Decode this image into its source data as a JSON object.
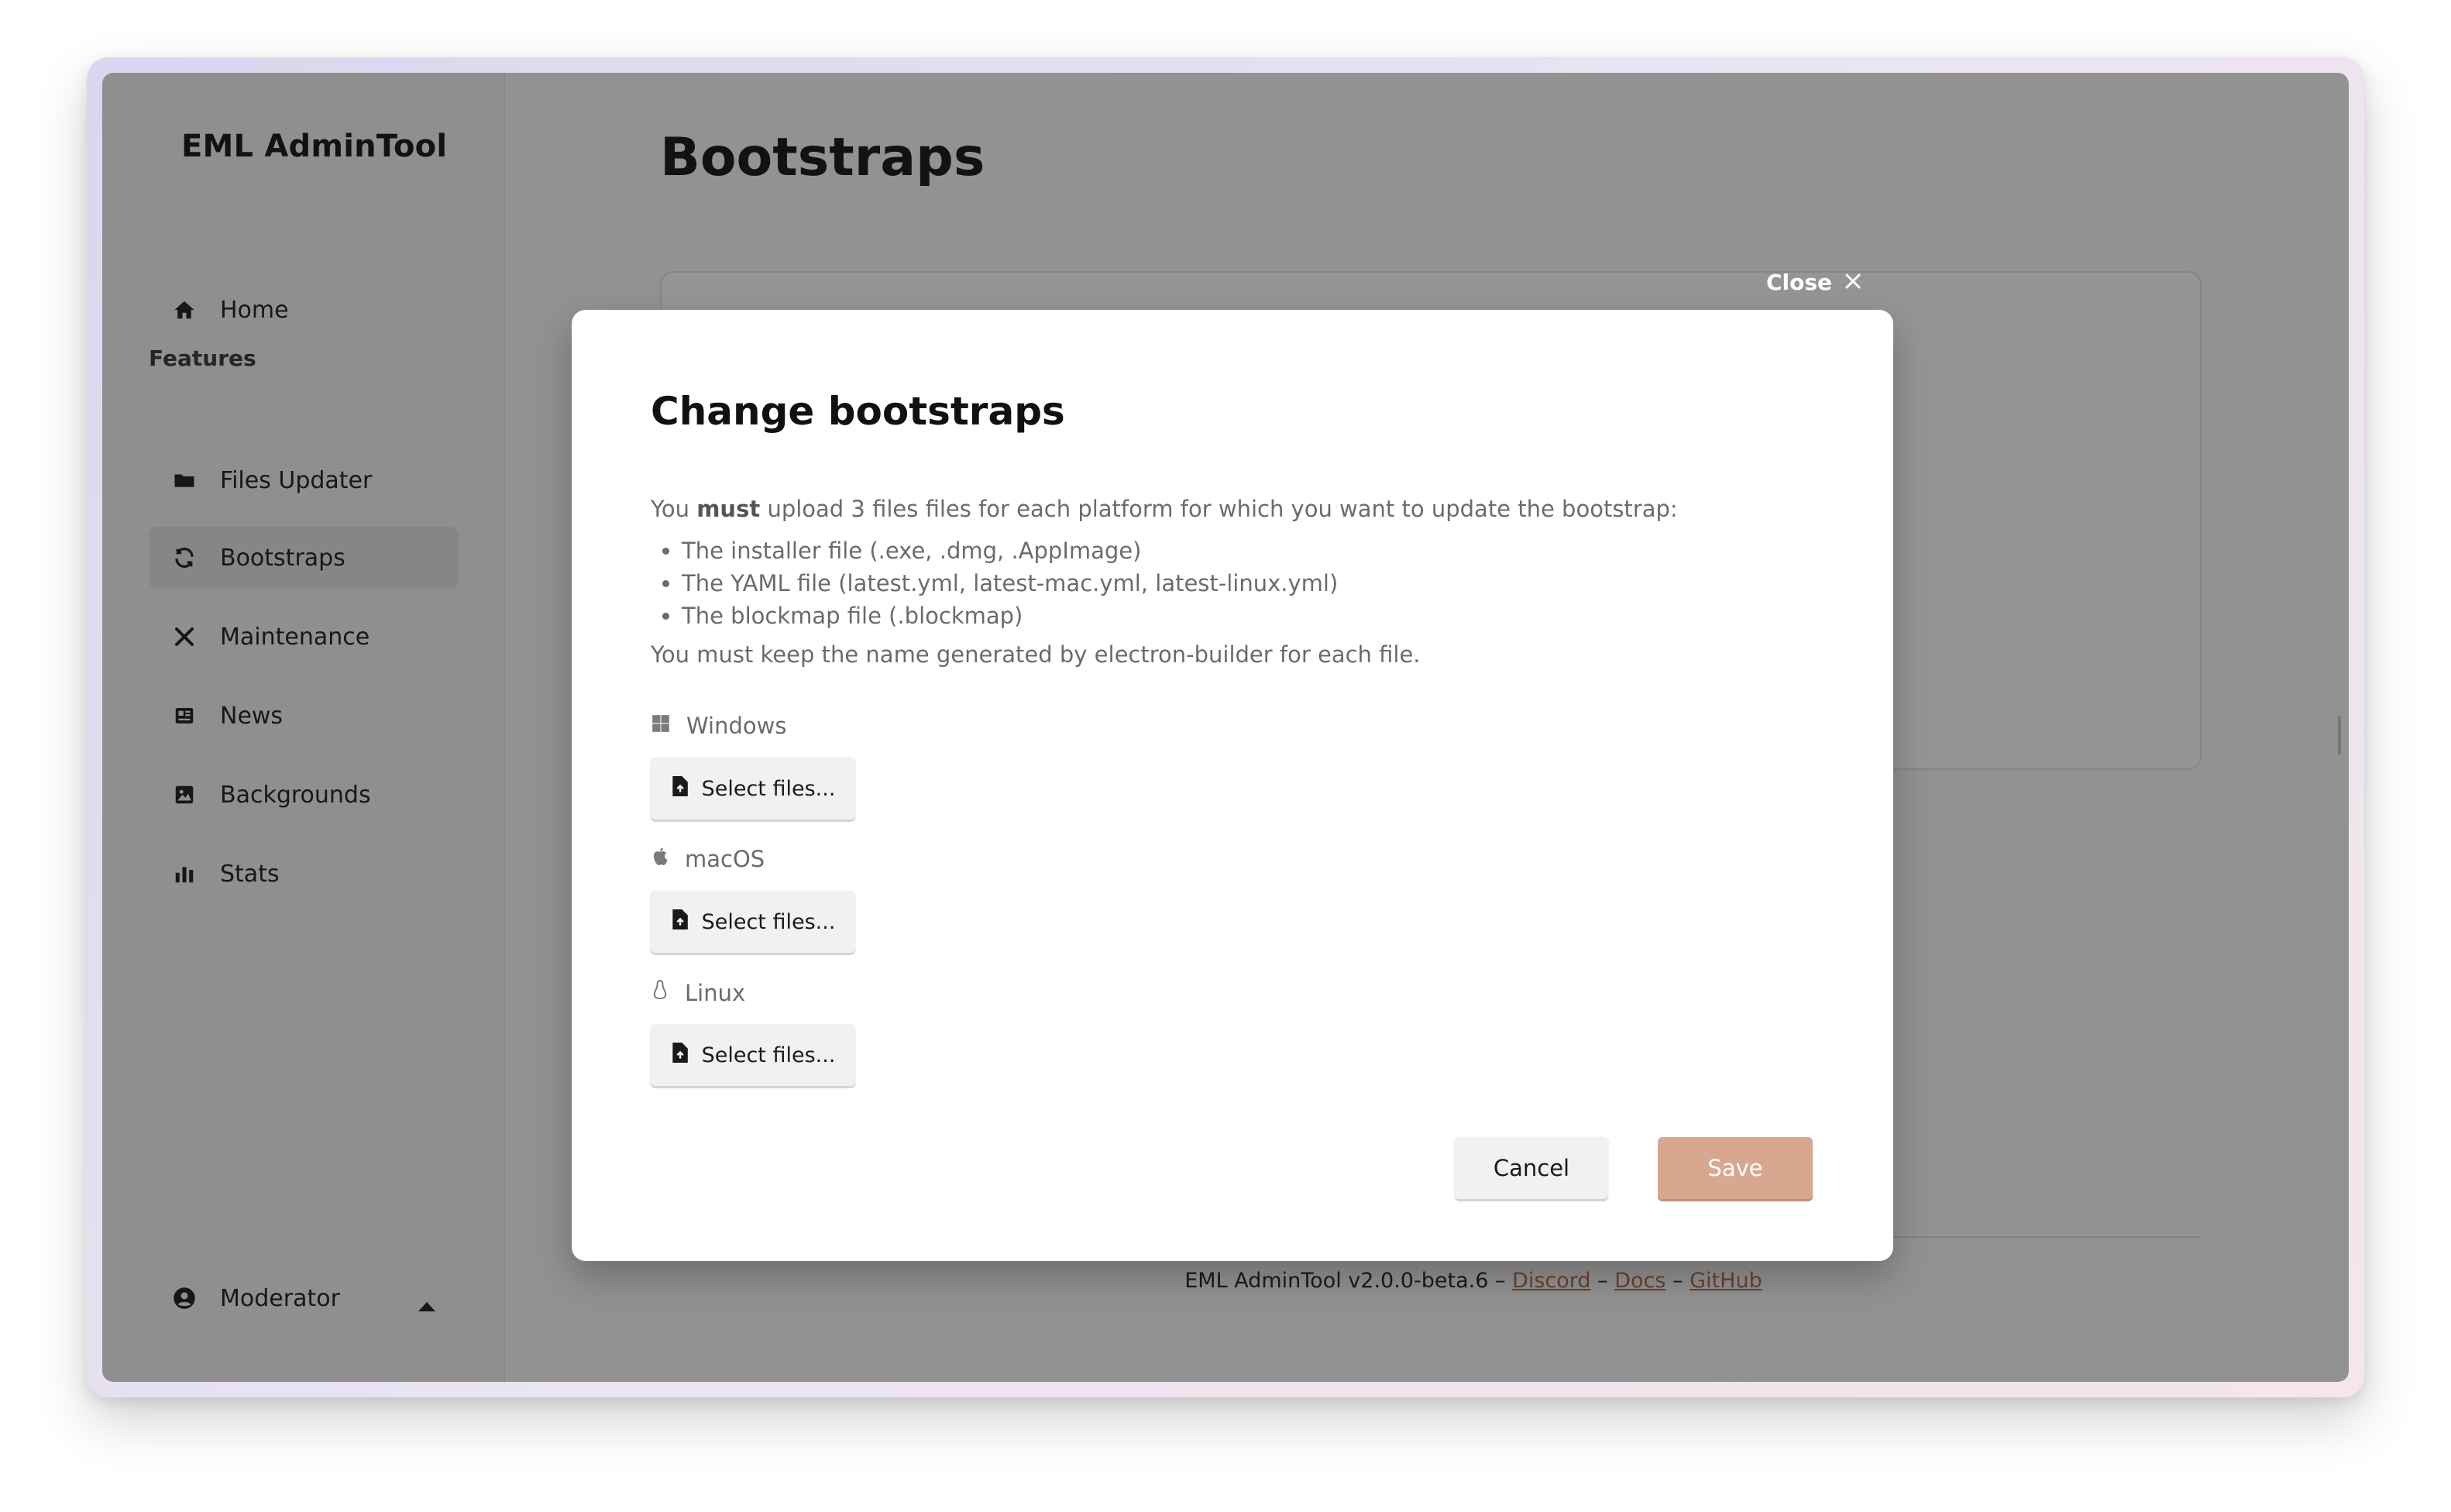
{
  "app": {
    "brand": "EML AdminTool"
  },
  "sidebar": {
    "home_label": "Home",
    "section_label": "Features",
    "items": [
      {
        "label": "Files Updater",
        "icon": "folder-icon"
      },
      {
        "label": "Bootstraps",
        "icon": "refresh-icon"
      },
      {
        "label": "Maintenance",
        "icon": "tools-icon"
      },
      {
        "label": "News",
        "icon": "newspaper-icon"
      },
      {
        "label": "Backgrounds",
        "icon": "image-icon"
      },
      {
        "label": "Stats",
        "icon": "bar-chart-icon"
      }
    ],
    "user_label": "Moderator"
  },
  "main": {
    "title": "Bootstraps"
  },
  "footer": {
    "prefix": "EML AdminTool v2.0.0-beta.6 –",
    "sep": "–",
    "links": [
      "Discord",
      "Docs",
      "GitHub"
    ]
  },
  "modal": {
    "close_label": "Close",
    "title": "Change bootstraps",
    "intro_you": "You",
    "intro_must": "must",
    "intro_rest": "upload 3 files files for each platform for which you want to update the bootstrap:",
    "requirements": [
      "The installer file (.exe, .dmg, .AppImage)",
      "The YAML file (latest.yml, latest-mac.yml, latest-linux.yml)",
      "The blockmap file (.blockmap)"
    ],
    "keep_note": "You must keep the name generated by electron-builder for each file.",
    "platforms": [
      {
        "name": "Windows",
        "button": "Select files..."
      },
      {
        "name": "macOS",
        "button": "Select files..."
      },
      {
        "name": "Linux",
        "button": "Select files..."
      }
    ],
    "cancel_label": "Cancel",
    "save_label": "Save"
  },
  "colors": {
    "accent": "#d8a78f",
    "link": "#b06a46"
  }
}
